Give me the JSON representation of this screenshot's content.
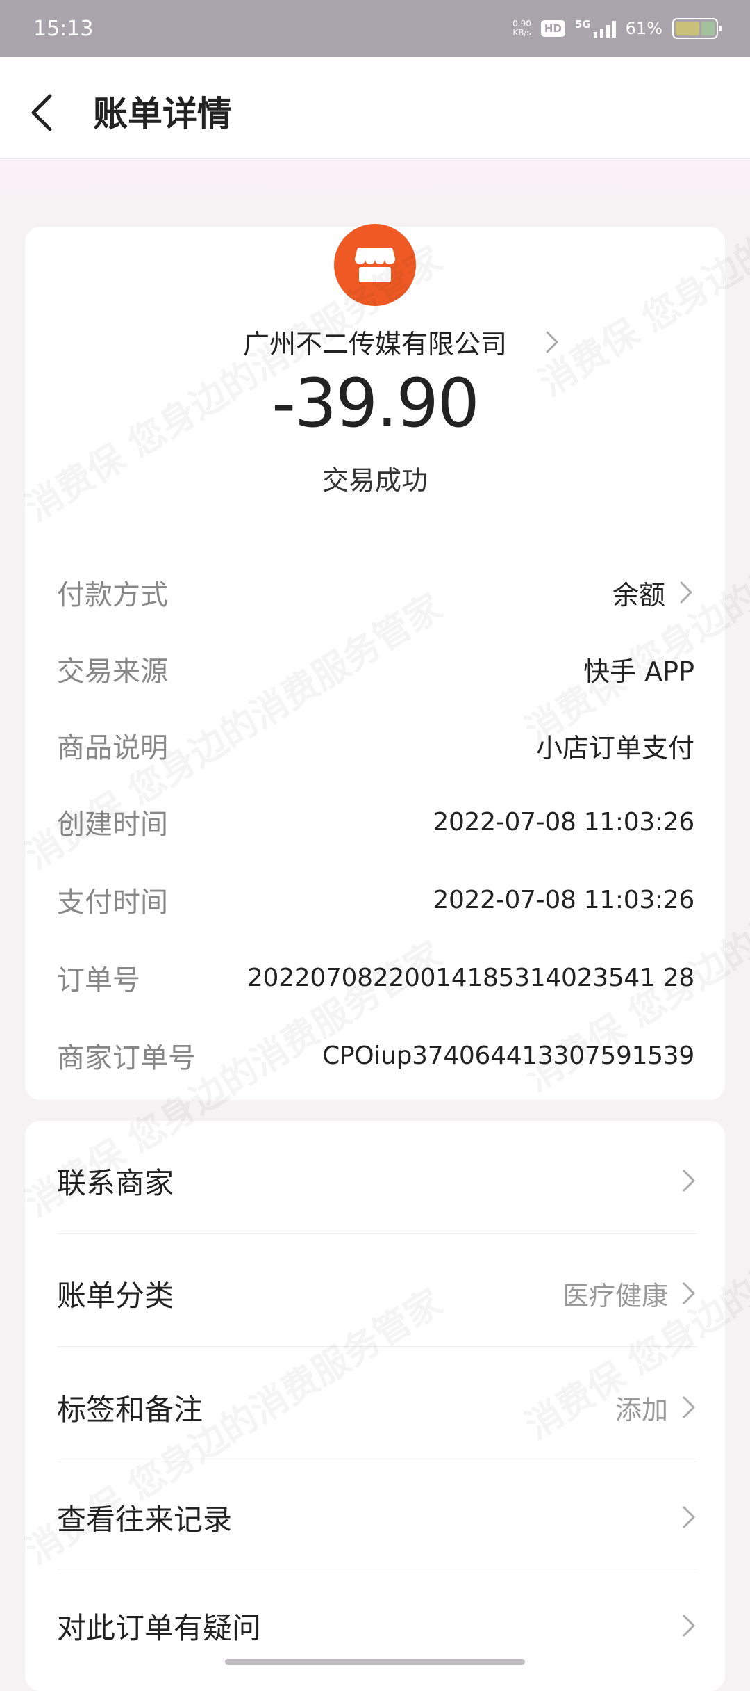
{
  "status_bar": {
    "time": "15:13",
    "net_speed_value": "0.90",
    "net_speed_unit": "KB/s",
    "hd": "HD",
    "network": "5G",
    "battery": "61%"
  },
  "header": {
    "title": "账单详情"
  },
  "transaction": {
    "merchant": "广州不二传媒有限公司",
    "amount": "-39.90",
    "status": "交易成功"
  },
  "details": [
    {
      "label": "付款方式",
      "value": "余额"
    },
    {
      "label": "交易来源",
      "value": "快手 APP"
    },
    {
      "label": "商品说明",
      "value": "小店订单支付"
    },
    {
      "label": "创建时间",
      "value": "2022-07-08 11:03:26"
    },
    {
      "label": "支付时间",
      "value": "2022-07-08 11:03:26"
    },
    {
      "label": "订单号",
      "value": "20220708220014185314023541 28"
    },
    {
      "label": "商家订单号",
      "value": "CPOiup374064413307591539"
    }
  ],
  "actions": [
    {
      "label": "联系商家",
      "value": ""
    },
    {
      "label": "账单分类",
      "value": "医疗健康"
    },
    {
      "label": "标签和备注",
      "value": "添加"
    },
    {
      "label": "查看往来记录",
      "value": ""
    },
    {
      "label": "对此订单有疑问",
      "value": ""
    }
  ],
  "watermark": [
    "消费保 您身边的消费服务管家"
  ],
  "colors": {
    "status_bar": "#a9a4ab",
    "merchant_logo": "#ef5a24",
    "background": "#f4f2f3"
  },
  "icons": {
    "back": "chevron-left-icon",
    "merchant": "store-icon",
    "row_arrow": "chevron-right-icon"
  }
}
